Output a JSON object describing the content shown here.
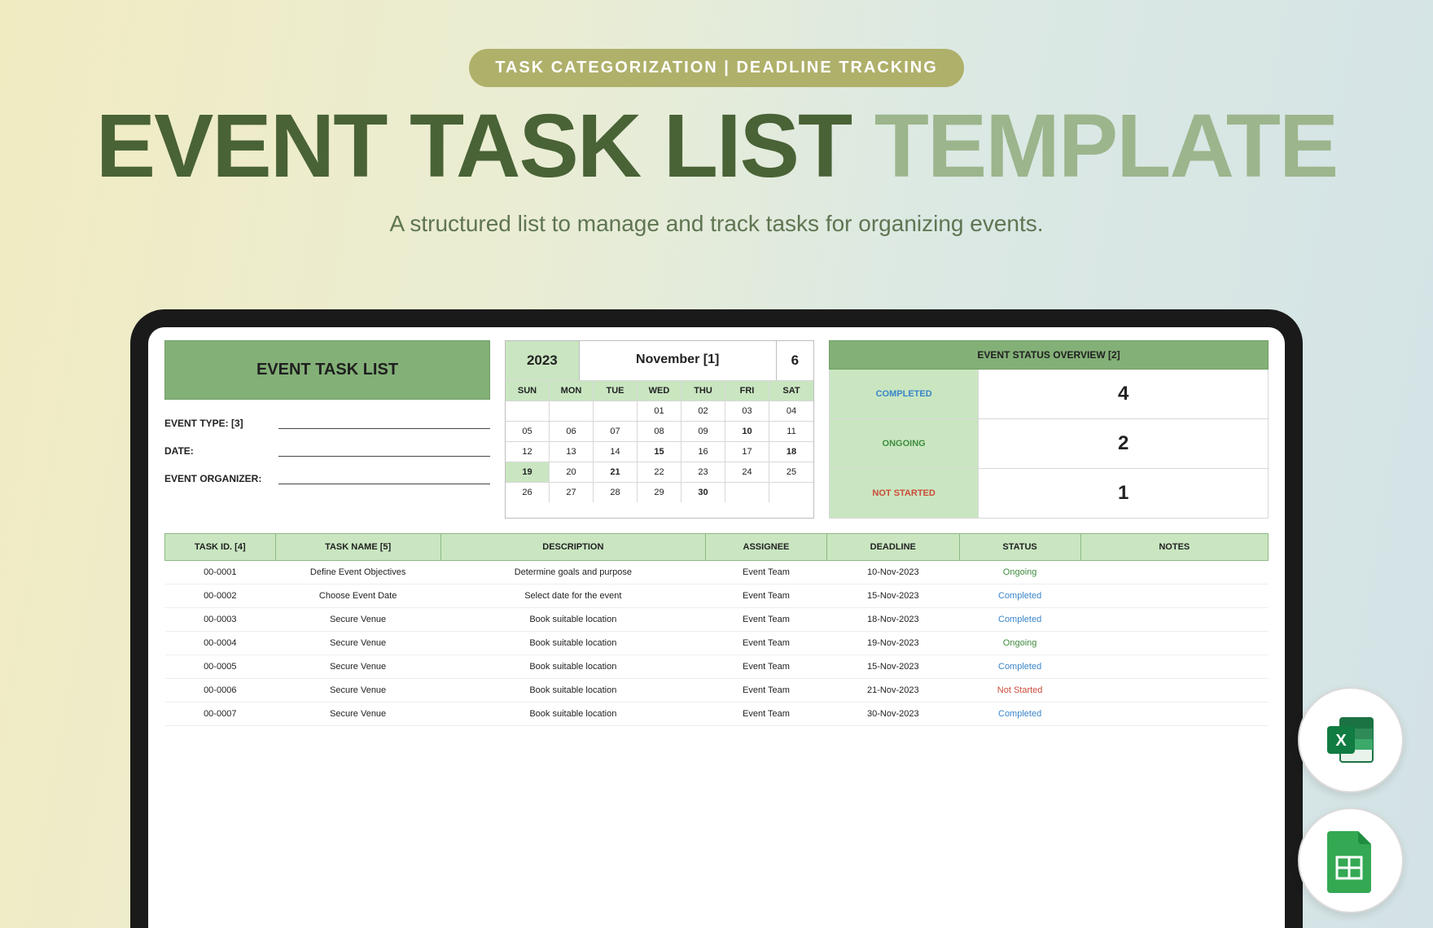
{
  "hero": {
    "pill": "TASK CATEGORIZATION  |  DEADLINE TRACKING",
    "title_dark": "EVENT TASK LIST",
    "title_light": " TEMPLATE",
    "subtitle": "A structured list to manage and track tasks for organizing events."
  },
  "sheet": {
    "title": "EVENT TASK LIST",
    "meta": {
      "event_type_label": "EVENT TYPE: [3]",
      "date_label": "DATE:",
      "organizer_label": "EVENT ORGANIZER:"
    },
    "calendar": {
      "year": "2023",
      "month": "November [1]",
      "day": "6",
      "dows": [
        "SUN",
        "MON",
        "TUE",
        "WED",
        "THU",
        "FRI",
        "SAT"
      ],
      "weeks": [
        [
          "",
          "",
          "",
          "01",
          "02",
          "03",
          "04"
        ],
        [
          "05",
          "06",
          "07",
          "08",
          "09",
          "10",
          "11"
        ],
        [
          "12",
          "13",
          "14",
          "15",
          "16",
          "17",
          "18"
        ],
        [
          "19",
          "20",
          "21",
          "22",
          "23",
          "24",
          "25"
        ],
        [
          "26",
          "27",
          "28",
          "29",
          "30",
          "",
          ""
        ]
      ],
      "highlighted": [
        "19"
      ],
      "bold": [
        "10",
        "15",
        "18",
        "21",
        "30"
      ]
    },
    "overview": {
      "title": "EVENT STATUS OVERVIEW [2]",
      "rows": [
        {
          "label": "COMPLETED",
          "cls": "c-blue",
          "value": "4"
        },
        {
          "label": "ONGOING",
          "cls": "c-green",
          "value": "2"
        },
        {
          "label": "NOT STARTED",
          "cls": "c-red",
          "value": "1"
        }
      ]
    },
    "columns": [
      "TASK ID. [4]",
      "TASK NAME [5]",
      "DESCRIPTION",
      "ASSIGNEE",
      "DEADLINE",
      "STATUS",
      "NOTES"
    ],
    "rows": [
      {
        "id": "00-0001",
        "name": "Define Event Objectives",
        "desc": "Determine goals and purpose",
        "assignee": "Event Team",
        "deadline": "10-Nov-2023",
        "status": "Ongoing",
        "cls": "status-ongoing",
        "notes": ""
      },
      {
        "id": "00-0002",
        "name": "Choose Event Date",
        "desc": "Select date for the event",
        "assignee": "Event Team",
        "deadline": "15-Nov-2023",
        "status": "Completed",
        "cls": "status-completed",
        "notes": ""
      },
      {
        "id": "00-0003",
        "name": "Secure Venue",
        "desc": "Book suitable location",
        "assignee": "Event Team",
        "deadline": "18-Nov-2023",
        "status": "Completed",
        "cls": "status-completed",
        "notes": ""
      },
      {
        "id": "00-0004",
        "name": "Secure Venue",
        "desc": "Book suitable location",
        "assignee": "Event Team",
        "deadline": "19-Nov-2023",
        "status": "Ongoing",
        "cls": "status-ongoing",
        "notes": ""
      },
      {
        "id": "00-0005",
        "name": "Secure Venue",
        "desc": "Book suitable location",
        "assignee": "Event Team",
        "deadline": "15-Nov-2023",
        "status": "Completed",
        "cls": "status-completed",
        "notes": ""
      },
      {
        "id": "00-0006",
        "name": "Secure Venue",
        "desc": "Book suitable location",
        "assignee": "Event Team",
        "deadline": "21-Nov-2023",
        "status": "Not Started",
        "cls": "status-notstarted",
        "notes": ""
      },
      {
        "id": "00-0007",
        "name": "Secure Venue",
        "desc": "Book suitable location",
        "assignee": "Event Team",
        "deadline": "30-Nov-2023",
        "status": "Completed",
        "cls": "status-completed",
        "notes": ""
      }
    ]
  },
  "icons": {
    "excel": "excel-icon",
    "sheets": "sheets-icon"
  }
}
